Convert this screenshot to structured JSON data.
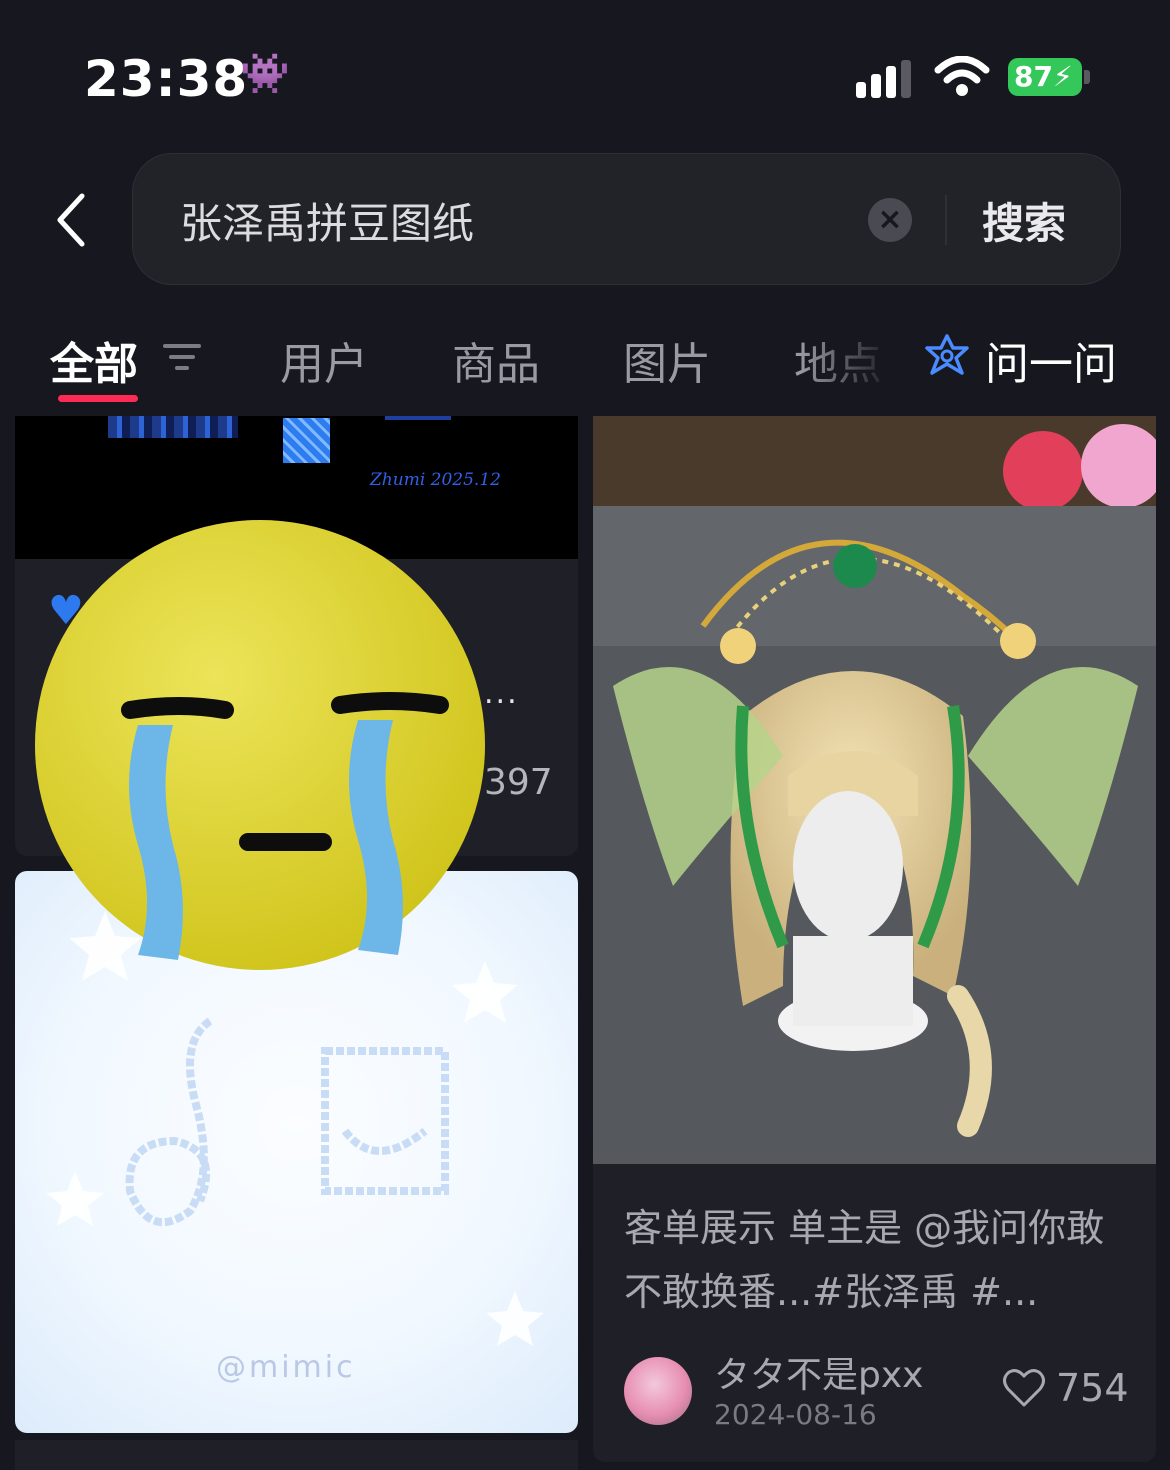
{
  "status_bar": {
    "time": "23:38",
    "battery": "87",
    "time_emoji": "👾"
  },
  "search": {
    "query": "张泽禹拼豆图纸",
    "button": "搜索"
  },
  "tabs": [
    {
      "label": "全部",
      "active": true
    },
    {
      "label": "用户"
    },
    {
      "label": "商品"
    },
    {
      "label": "图片"
    },
    {
      "label": "地点"
    }
  ],
  "ask": {
    "label": "问一问"
  },
  "feed": {
    "left_top": {
      "signature": "Zhumi 2025.12",
      "likes": "397",
      "more": "..."
    },
    "left_bottom": {
      "watermark": "@mimic"
    },
    "right": {
      "title": "客单展示 单主是 @我问你敢不敢换番...#张泽禹 #...",
      "author": "タタ不是pxx",
      "date": "2024-08-16",
      "likes": "754"
    }
  },
  "colors": {
    "accent": "#fe2c55",
    "background": "#17171f",
    "ask_icon": "#4a8cff"
  }
}
